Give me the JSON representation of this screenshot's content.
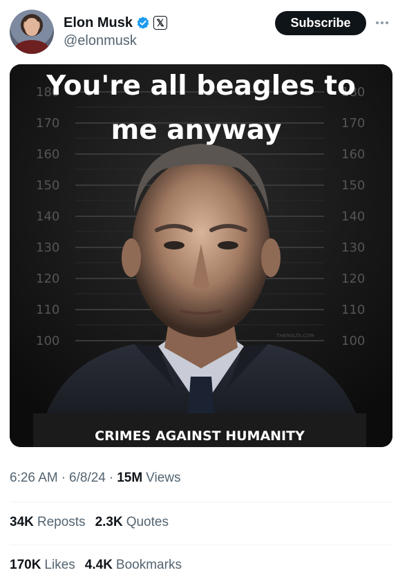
{
  "author": {
    "display_name": "Elon Musk",
    "handle": "@elonmusk",
    "verified_icon": "verified-badge-icon",
    "affiliation_icon": "x-logo-icon",
    "affiliation_glyph": "𝕏"
  },
  "actions": {
    "subscribe_label": "Subscribe",
    "more_icon": "more-horizontal-icon"
  },
  "media": {
    "top_text_line1": "You're all beagles to",
    "top_text_line2": "me anyway",
    "caption": "CRIMES AGAINST HUMANITY",
    "height_marks": [
      "180",
      "170",
      "160",
      "150",
      "140",
      "130",
      "120",
      "110",
      "100"
    ],
    "watermark": "THEMALTA.COM"
  },
  "meta": {
    "time": "6:26 AM",
    "date": "6/8/24",
    "views_count": "15M",
    "views_label": "Views"
  },
  "stats": {
    "reposts_count": "34K",
    "reposts_label": "Reposts",
    "quotes_count": "2.3K",
    "quotes_label": "Quotes",
    "likes_count": "170K",
    "likes_label": "Likes",
    "bookmarks_count": "4.4K",
    "bookmarks_label": "Bookmarks"
  },
  "colors": {
    "verified_blue": "#1d9bf0",
    "text_primary": "#0f1419",
    "text_secondary": "#536471"
  }
}
